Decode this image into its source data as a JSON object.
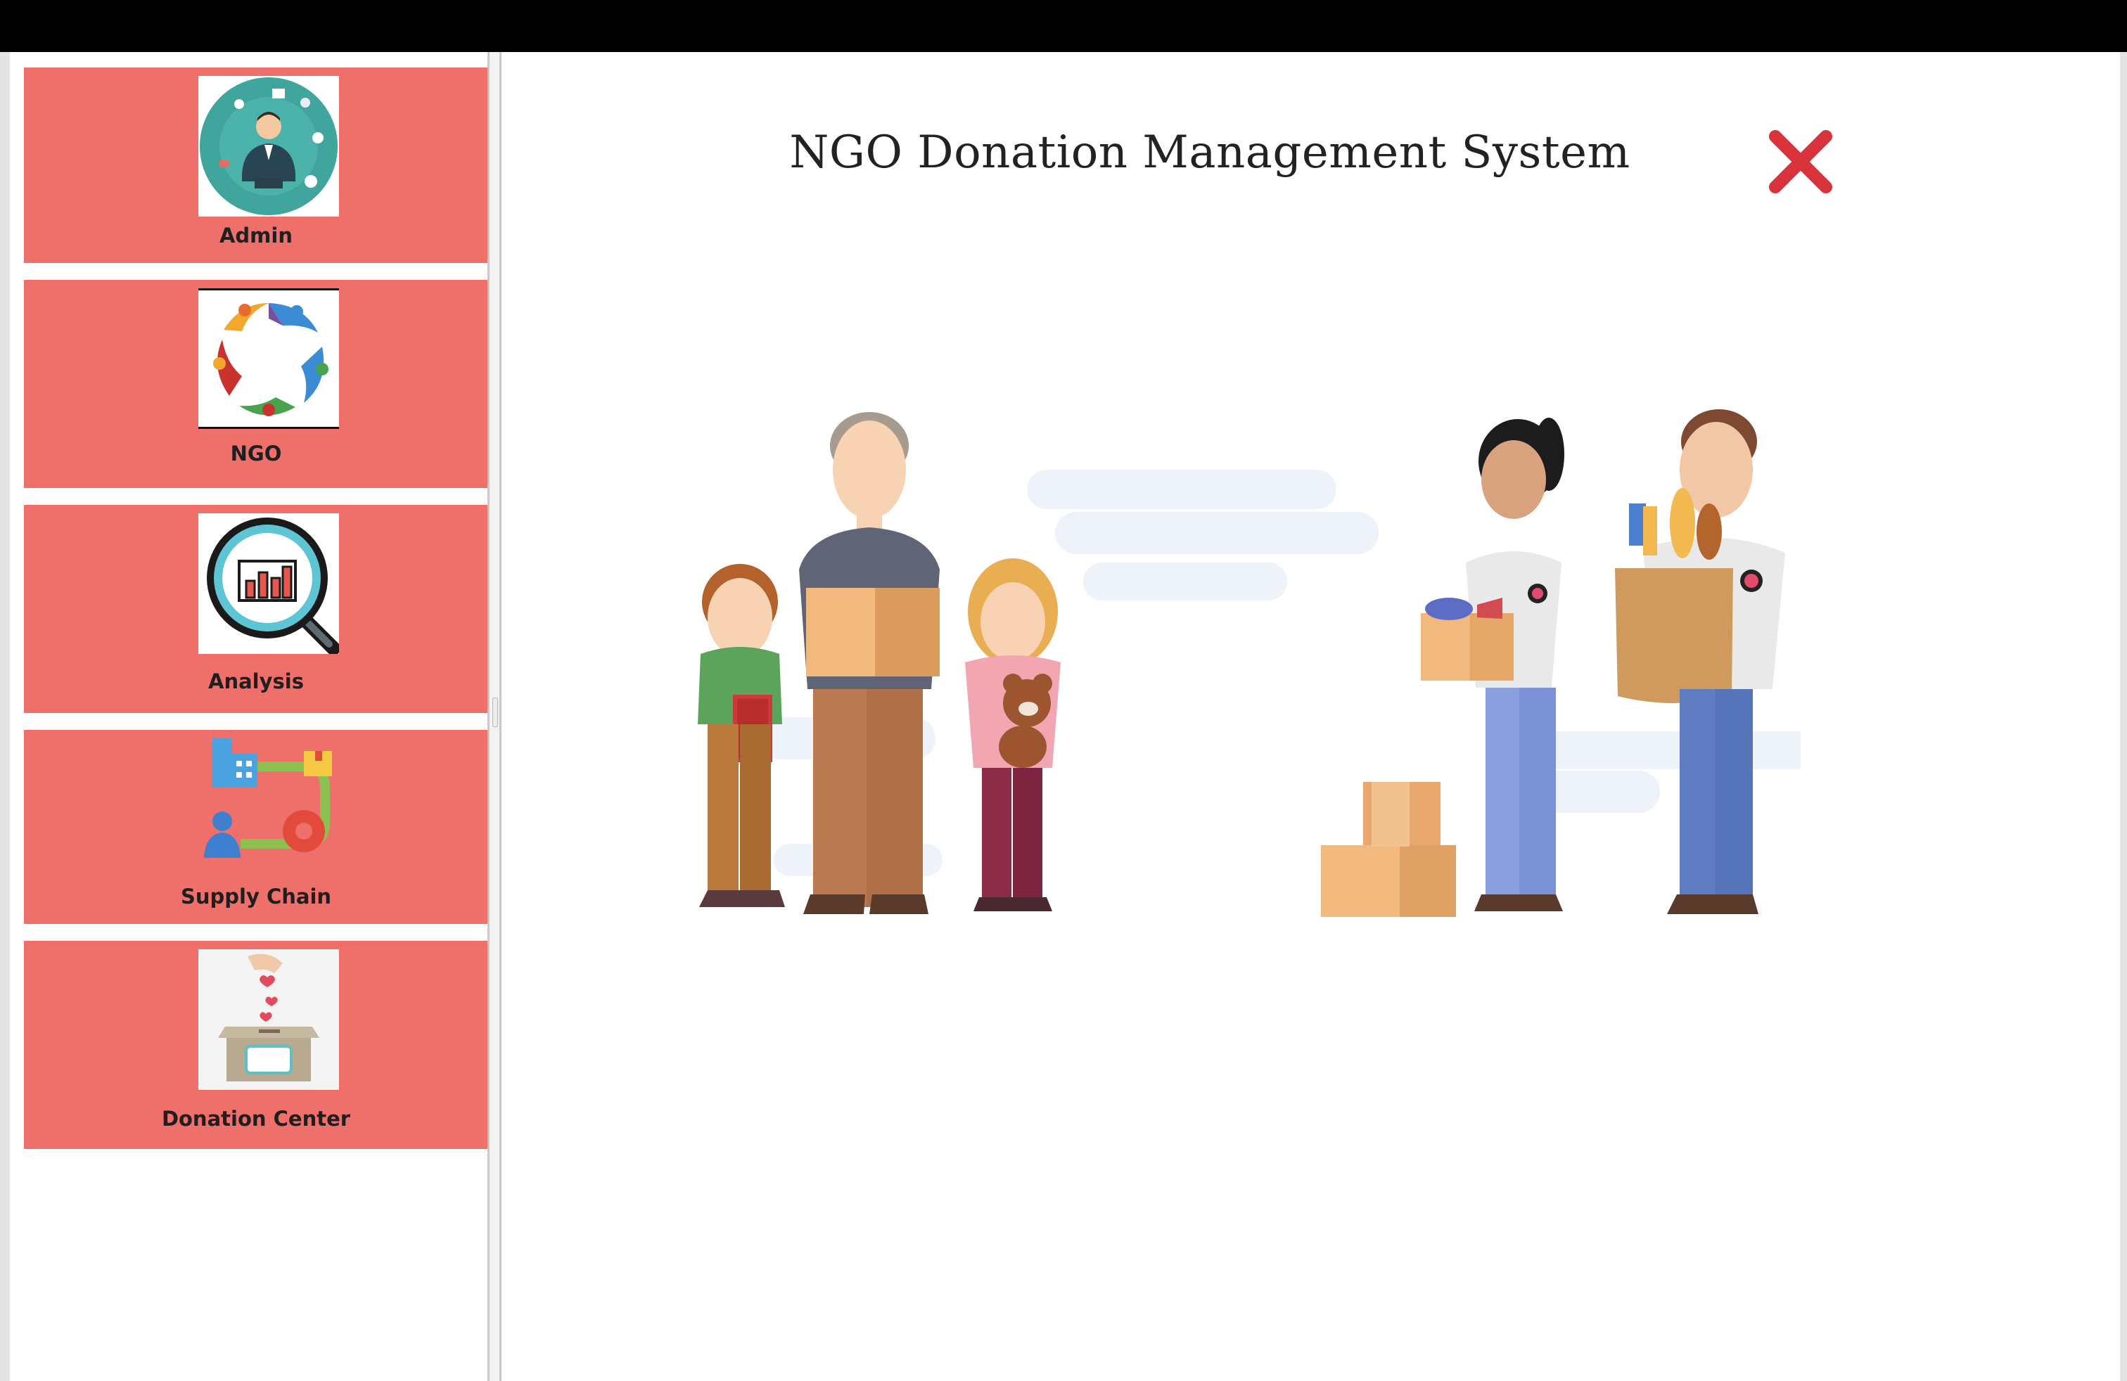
{
  "app": {
    "title": "NGO Donation Management System"
  },
  "sidebar": {
    "items": [
      {
        "label": "Admin",
        "icon": "admin-avatar-icon"
      },
      {
        "label": "NGO",
        "icon": "ngo-people-circle-icon"
      },
      {
        "label": "Analysis",
        "icon": "magnifier-chart-icon"
      },
      {
        "label": "Supply Chain",
        "icon": "supply-chain-icon"
      },
      {
        "label": "Donation Center",
        "icon": "donation-box-icon"
      }
    ]
  },
  "header": {
    "close_icon": "close-icon"
  },
  "colors": {
    "tile": "#ef6f6b",
    "close": "#d8323a",
    "topbar": "#000000"
  }
}
